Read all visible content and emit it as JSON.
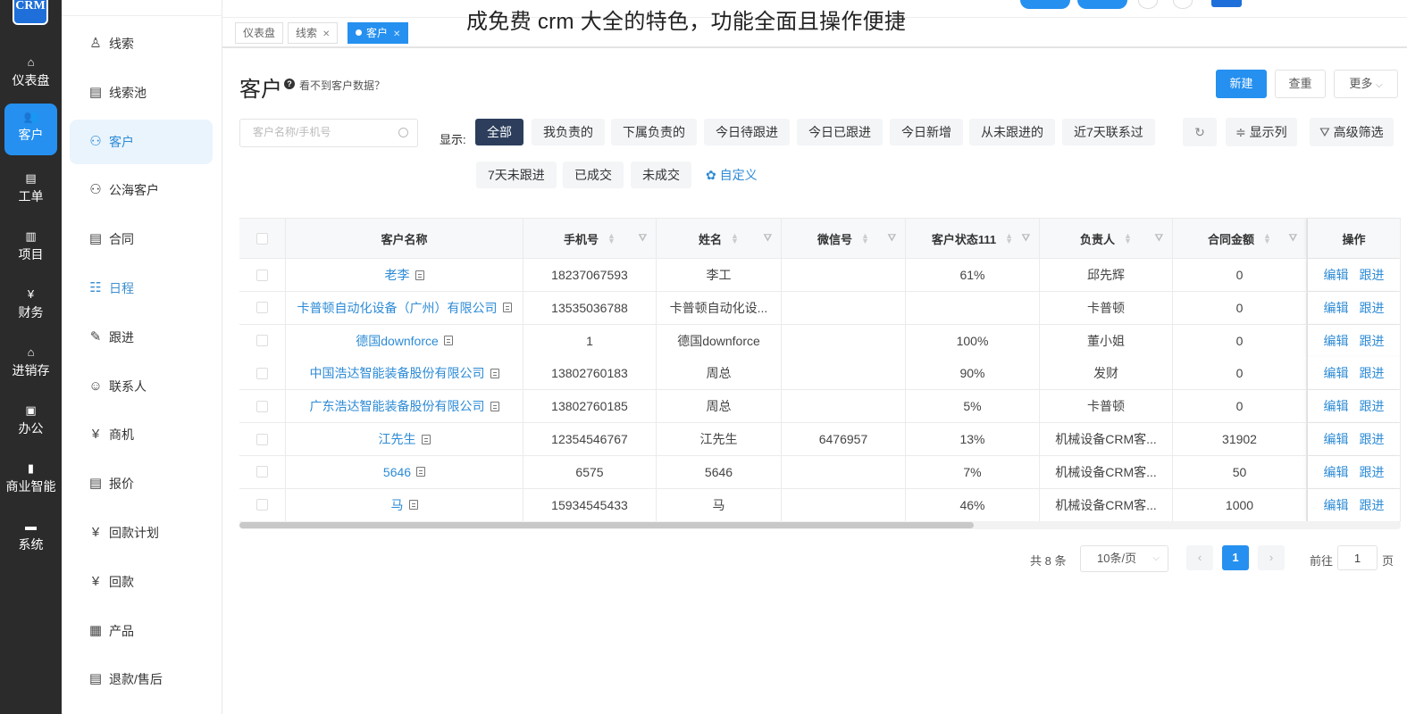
{
  "rail": {
    "logo": "CRM",
    "items": [
      {
        "label": "仪表盘",
        "icon": "home-icon"
      },
      {
        "label": "客户",
        "icon": "customers-icon",
        "active": true
      },
      {
        "label": "工单",
        "icon": "clipboard-icon"
      },
      {
        "label": "项目",
        "icon": "books-icon"
      },
      {
        "label": "财务",
        "icon": "finance-icon"
      },
      {
        "label": "进销存",
        "icon": "warehouse-icon"
      },
      {
        "label": "办公",
        "icon": "office-icon"
      },
      {
        "label": "商业智能",
        "icon": "bar-chart-icon"
      },
      {
        "label": "系统",
        "icon": "system-icon"
      }
    ]
  },
  "subnav": {
    "items": [
      {
        "label": "线索",
        "icon": "lead-icon"
      },
      {
        "label": "线索池",
        "icon": "lead-pool-icon"
      },
      {
        "label": "客户",
        "icon": "customer-icon",
        "active": true
      },
      {
        "label": "公海客户",
        "icon": "public-customers-icon"
      },
      {
        "label": "合同",
        "icon": "contract-icon"
      },
      {
        "label": "日程",
        "icon": "schedule-icon",
        "highlight": true
      },
      {
        "label": "跟进",
        "icon": "follow-up-icon"
      },
      {
        "label": "联系人",
        "icon": "contact-icon"
      },
      {
        "label": "商机",
        "icon": "opportunity-icon"
      },
      {
        "label": "报价",
        "icon": "quote-icon"
      },
      {
        "label": "回款计划",
        "icon": "payment-plan-icon"
      },
      {
        "label": "回款",
        "icon": "payment-icon"
      },
      {
        "label": "产品",
        "icon": "product-icon"
      },
      {
        "label": "退款/售后",
        "icon": "refund-icon"
      }
    ]
  },
  "watermark": "成免费 crm 大全的特色，功能全面且操作便捷",
  "tabs": [
    {
      "label": "仪表盘",
      "closable": false
    },
    {
      "label": "线索",
      "closable": true
    },
    {
      "label": "客户",
      "closable": true,
      "active": true
    }
  ],
  "page": {
    "title": "客户",
    "help_text": "看不到客户数据？",
    "buttons": {
      "new": "新建",
      "dedupe": "查重",
      "more": "更多"
    }
  },
  "filters": {
    "search_placeholder": "客户名称/手机号",
    "show_label": "显示:",
    "chips": [
      "全部",
      "我负责的",
      "下属负责的",
      "今日待跟进",
      "今日已跟进",
      "今日新增",
      "从未跟进的",
      "近7天联系过",
      "7天未跟进",
      "已成交",
      "未成交"
    ],
    "custom_label": "自定义",
    "tools": {
      "columns": "显示列",
      "advanced": "高级筛选"
    }
  },
  "table": {
    "columns": [
      "客户名称",
      "手机号",
      "姓名",
      "微信号",
      "客户状态111",
      "负责人",
      "合同金额",
      "操作"
    ],
    "actions": {
      "edit": "编辑",
      "follow": "跟进"
    },
    "rows": [
      {
        "name": "老李",
        "phone": "18237067593",
        "contact": "李工",
        "wechat": "",
        "status": "61%",
        "owner": "邱先辉",
        "amount": "0"
      },
      {
        "name": "卡普顿自动化设备（广州）有限公司",
        "phone": "13535036788",
        "contact": "卡普顿自动化设...",
        "wechat": "",
        "status": "",
        "owner": "卡普顿",
        "amount": "0"
      },
      {
        "name": "德国downforce",
        "phone": "1",
        "contact": "德国downforce",
        "wechat": "",
        "status": "100%",
        "owner": "董小姐",
        "amount": "0"
      },
      {
        "name": "中国浩达智能装备股份有限公司",
        "phone": "13802760183",
        "contact": "周总",
        "wechat": "",
        "status": "90%",
        "owner": "发财",
        "amount": "0"
      },
      {
        "name": "广东浩达智能装备股份有限公司",
        "phone": "13802760185",
        "contact": "周总",
        "wechat": "",
        "status": "5%",
        "owner": "卡普顿",
        "amount": "0"
      },
      {
        "name": "江先生",
        "phone": "12354546767",
        "contact": "江先生",
        "wechat": "6476957",
        "status": "13%",
        "owner": "机械设备CRM客...",
        "amount": "31902"
      },
      {
        "name": "5646",
        "phone": "6575",
        "contact": "5646",
        "wechat": "",
        "status": "7%",
        "owner": "机械设备CRM客...",
        "amount": "50"
      },
      {
        "name": "马",
        "phone": "15934545433",
        "contact": "马",
        "wechat": "",
        "status": "46%",
        "owner": "机械设备CRM客...",
        "amount": "1000"
      }
    ]
  },
  "pagination": {
    "total": "共 8 条",
    "page_size": "10条/页",
    "current_page": "1",
    "goto_label": "前往",
    "goto_value": "1",
    "page_suffix": "页"
  }
}
